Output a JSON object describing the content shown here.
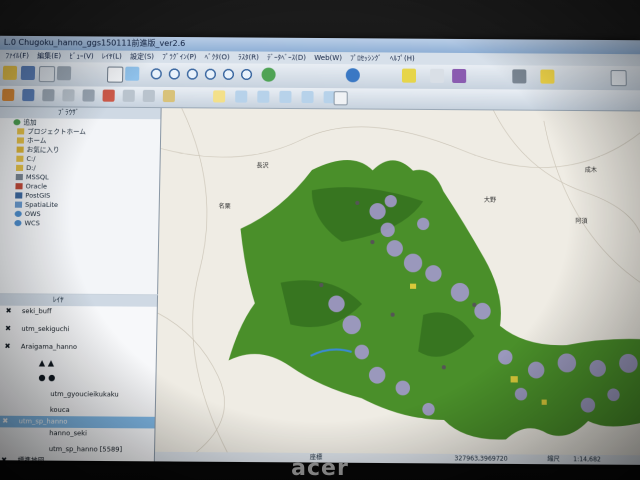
{
  "window": {
    "title": "L.0 Chugoku_hanno_ggs150111前進版_ver2.6"
  },
  "menu": [
    "ﾌｧｲﾙ(F)",
    "編集(E)",
    "ﾋﾞｭｰ(V)",
    "ﾚｲﾔ(L)",
    "設定(S)",
    "ﾌﾟﾗｸﾞｲﾝ(P)",
    "ﾍﾞｸﾀ(O)",
    "ﾗｽﾀ(R)",
    "ﾃﾞｰﾀﾍﾞｰｽ(D)",
    "Web(W)",
    "ﾌﾟﾛｾｯｼﾝｸﾞ",
    "ﾍﾙﾌﾟ(H)"
  ],
  "browser_panel": {
    "title": "ﾌﾞﾗｳｻﾞ",
    "add_label": "追加",
    "items": [
      "プロジェクトホーム",
      "ホーム",
      "お気に入り",
      "C:/",
      "D:/",
      "MSSQL",
      "Oracle",
      "PostGIS",
      "SpatiaLite",
      "OWS",
      "WCS"
    ]
  },
  "layers_panel": {
    "title": "ﾚｲﾔ",
    "items": [
      "seki_buff",
      "utm_sekiguchi",
      "Araigama_hanno",
      "utm_gyoucieikukaku",
      "kouca",
      "utm_sp_hanno",
      "hanno_seki",
      "utm_sp_hanno [5589]",
      "標準地図"
    ]
  },
  "map": {
    "place_labels": [
      "長沢",
      "名栗",
      "大野",
      "阿須",
      "成木"
    ]
  },
  "status": {
    "coord_label": "座標",
    "coord_value": "327963,3969720",
    "scale_label": "縮尺",
    "scale_value": "1:14,682"
  },
  "logo": "acer",
  "colors": {
    "forest": "#4a8f2a",
    "forest_dark": "#2f6a1c",
    "purple": "#a99ad6",
    "selection": "#7fb8e6",
    "basemap": "#efece4"
  }
}
